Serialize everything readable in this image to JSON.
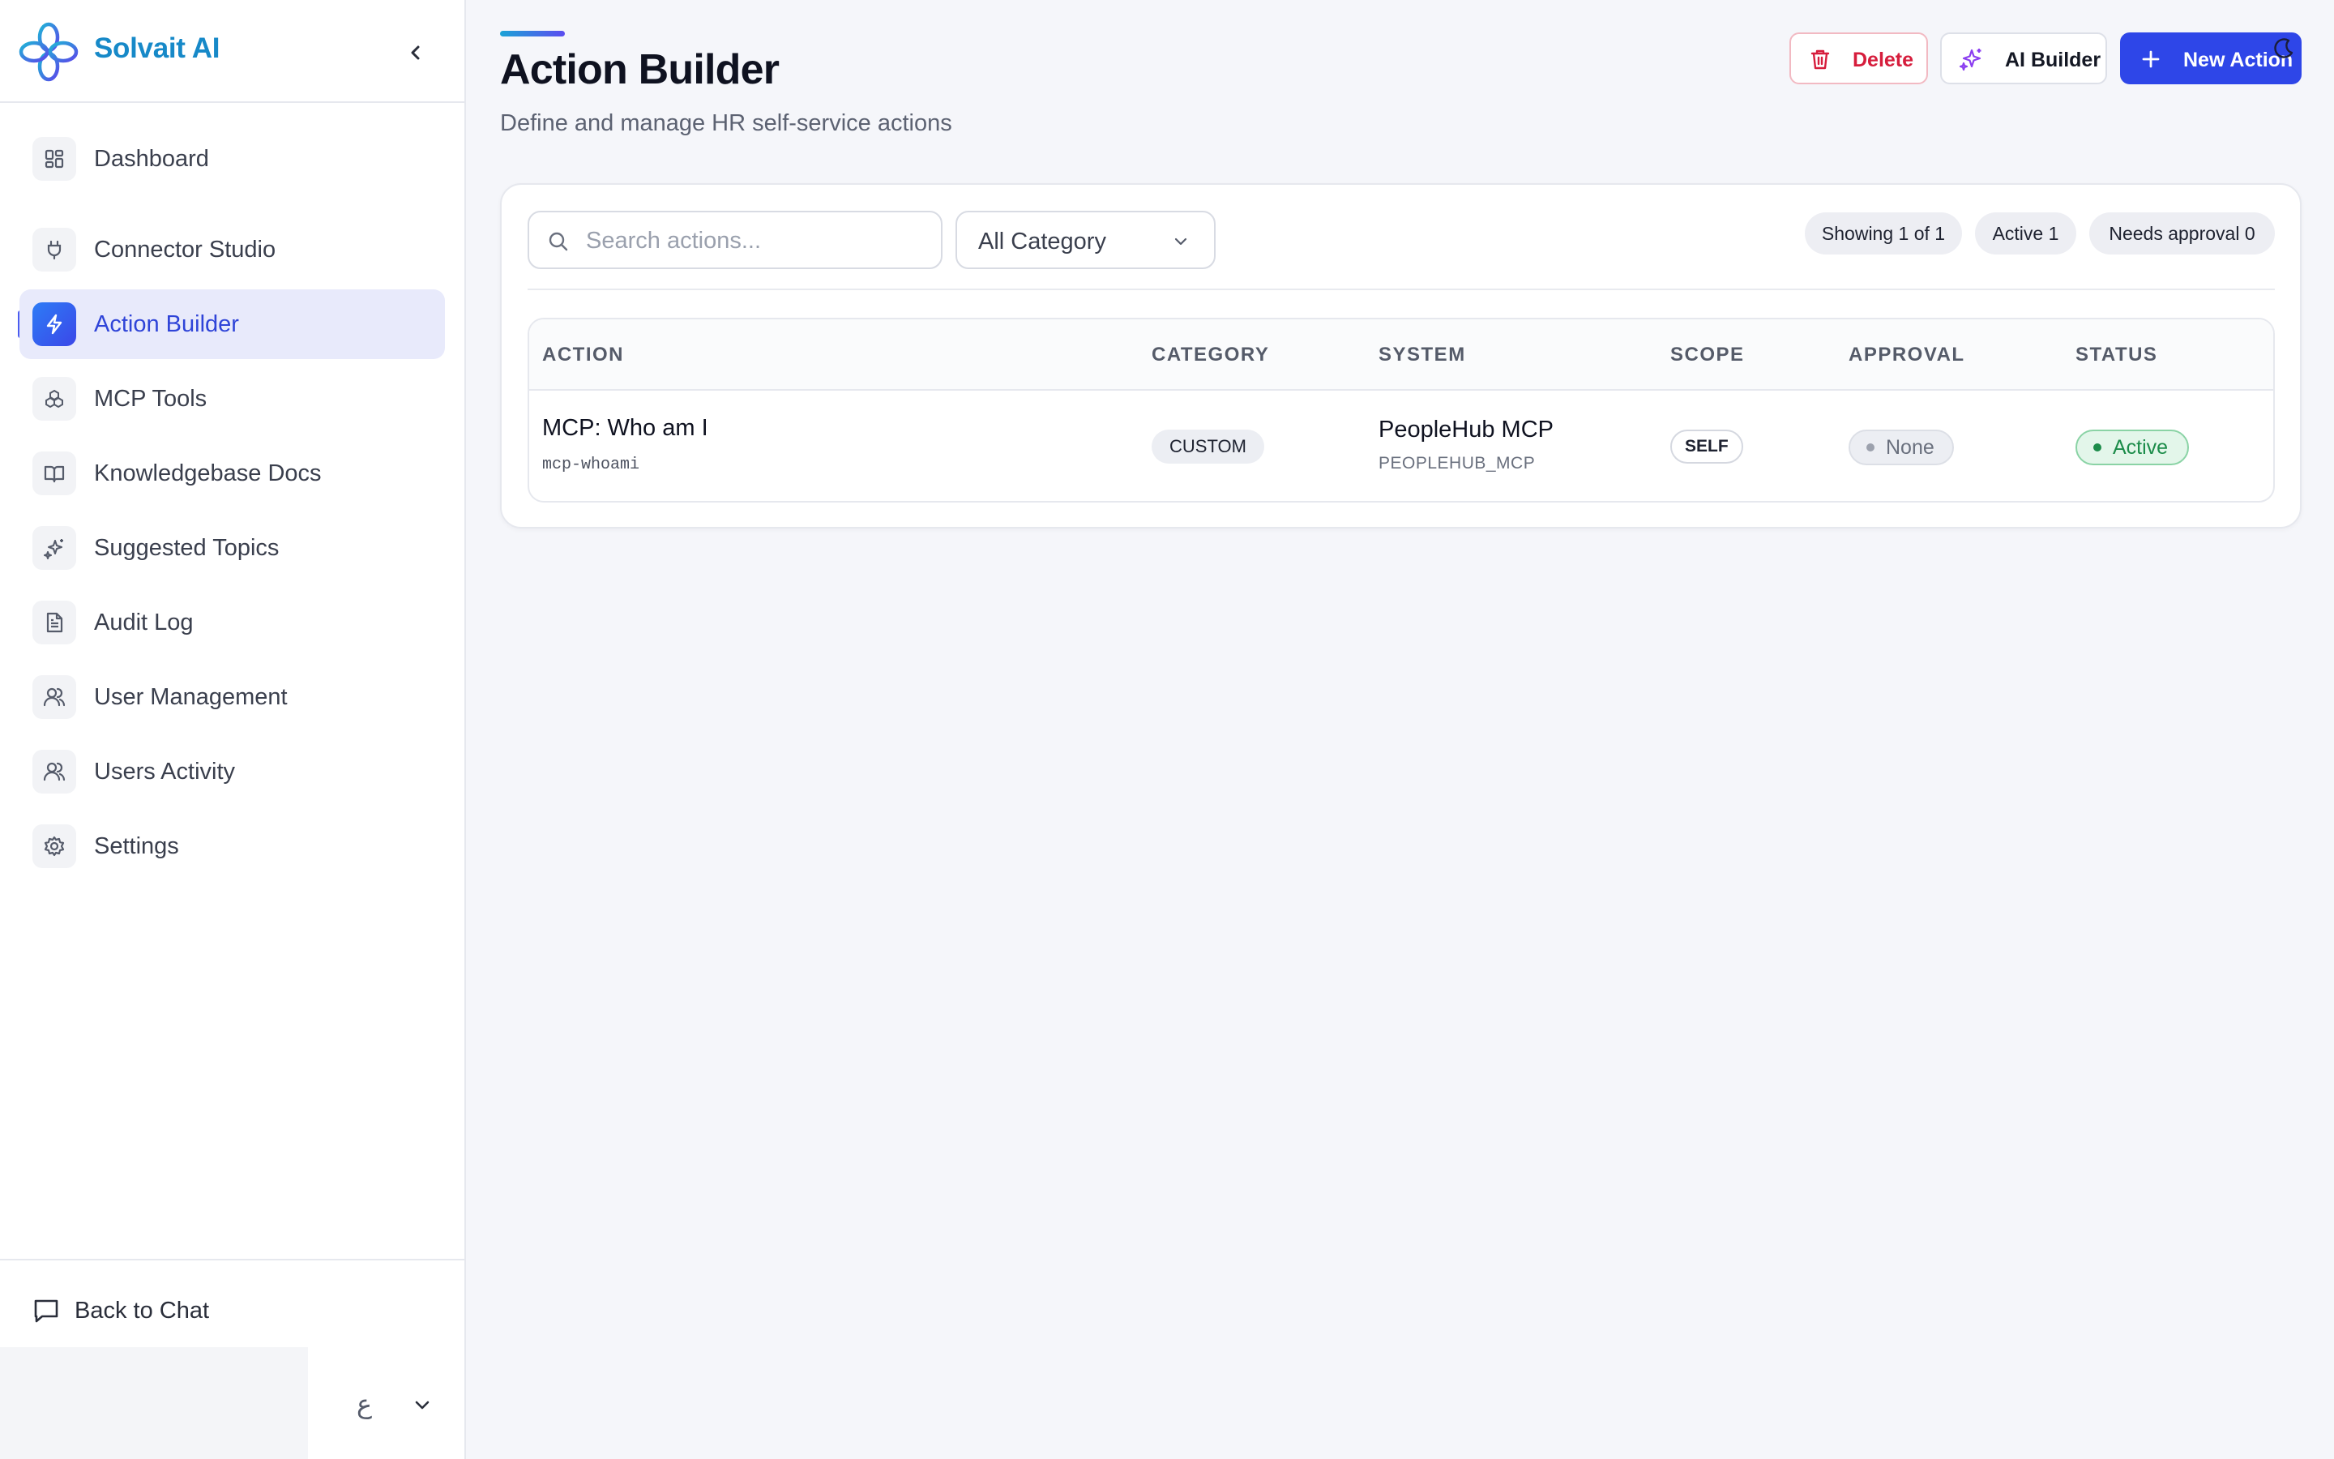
{
  "brand": {
    "name": "Solvait AI"
  },
  "sidebar": {
    "items": [
      {
        "label": "Dashboard",
        "icon": "dashboard-icon"
      },
      {
        "label": "Connector Studio",
        "icon": "plug-icon"
      },
      {
        "label": "Action Builder",
        "icon": "lightning-icon",
        "active": true
      },
      {
        "label": "MCP Tools",
        "icon": "cubes-icon"
      },
      {
        "label": "Knowledgebase Docs",
        "icon": "book-icon"
      },
      {
        "label": "Suggested Topics",
        "icon": "sparkles-icon"
      },
      {
        "label": "Audit Log",
        "icon": "document-icon"
      },
      {
        "label": "User Management",
        "icon": "users-icon"
      },
      {
        "label": "Users Activity",
        "icon": "users-icon"
      },
      {
        "label": "Settings",
        "icon": "gear-icon"
      }
    ],
    "footer": {
      "back_label": "Back to Chat",
      "language": "ع"
    }
  },
  "header": {
    "title": "Action Builder",
    "subtitle": "Define and manage HR self-service actions",
    "buttons": {
      "delete": "Delete",
      "ai_builder": "AI Builder",
      "new_action": "New Action"
    }
  },
  "filters": {
    "search_placeholder": "Search actions...",
    "category_value": "All Category",
    "stats": {
      "showing": "Showing 1 of 1",
      "active": "Active 1",
      "needs_approval": "Needs approval 0"
    }
  },
  "table": {
    "columns": [
      "ACTION",
      "CATEGORY",
      "SYSTEM",
      "SCOPE",
      "APPROVAL",
      "STATUS"
    ],
    "rows": [
      {
        "name": "MCP: Who am I",
        "key": "mcp-whoami",
        "category": "CUSTOM",
        "system": "PeopleHub MCP",
        "system_key": "PEOPLEHUB_MCP",
        "scope": "SELF",
        "approval": "None",
        "status": "Active"
      }
    ]
  },
  "colors": {
    "brand": "#1789c8",
    "accent": "#2e46e8",
    "danger": "#d61d3c",
    "success": "#1c8c4a"
  }
}
